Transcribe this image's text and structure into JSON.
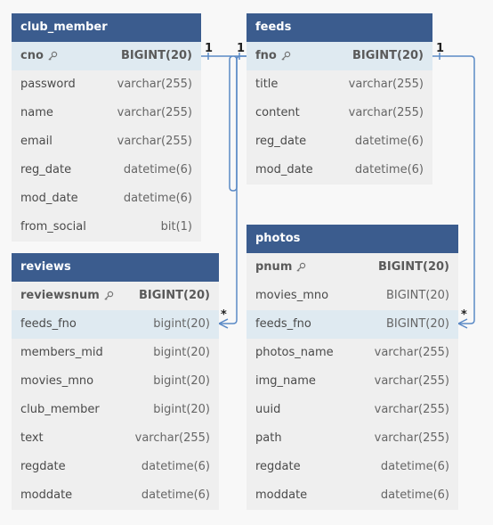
{
  "tables": {
    "club_member": {
      "title": "club_member",
      "rows": [
        {
          "name": "cno",
          "type": "BIGINT(20)",
          "pk": true
        },
        {
          "name": "password",
          "type": "varchar(255)"
        },
        {
          "name": "name",
          "type": "varchar(255)"
        },
        {
          "name": "email",
          "type": "varchar(255)"
        },
        {
          "name": "reg_date",
          "type": "datetime(6)"
        },
        {
          "name": "mod_date",
          "type": "datetime(6)"
        },
        {
          "name": "from_social",
          "type": "bit(1)"
        }
      ]
    },
    "feeds": {
      "title": "feeds",
      "rows": [
        {
          "name": "fno",
          "type": "BIGINT(20)",
          "pk": true
        },
        {
          "name": "title",
          "type": "varchar(255)"
        },
        {
          "name": "content",
          "type": "varchar(255)"
        },
        {
          "name": "reg_date",
          "type": "datetime(6)"
        },
        {
          "name": "mod_date",
          "type": "datetime(6)"
        }
      ]
    },
    "reviews": {
      "title": "reviews",
      "rows": [
        {
          "name": "reviewsnum",
          "type": "BIGINT(20)",
          "pk": true
        },
        {
          "name": "feeds_fno",
          "type": "bigint(20)"
        },
        {
          "name": "members_mid",
          "type": "bigint(20)"
        },
        {
          "name": "movies_mno",
          "type": "bigint(20)"
        },
        {
          "name": "club_member",
          "type": "bigint(20)"
        },
        {
          "name": "text",
          "type": "varchar(255)"
        },
        {
          "name": "regdate",
          "type": "datetime(6)"
        },
        {
          "name": "moddate",
          "type": "datetime(6)"
        }
      ]
    },
    "photos": {
      "title": "photos",
      "rows": [
        {
          "name": "pnum",
          "type": "BIGINT(20)",
          "pk": true
        },
        {
          "name": "movies_mno",
          "type": "BIGINT(20)"
        },
        {
          "name": "feeds_fno",
          "type": "BIGINT(20)"
        },
        {
          "name": "photos_name",
          "type": "varchar(255)"
        },
        {
          "name": "img_name",
          "type": "varchar(255)"
        },
        {
          "name": "uuid",
          "type": "varchar(255)"
        },
        {
          "name": "path",
          "type": "varchar(255)"
        },
        {
          "name": "regdate",
          "type": "datetime(6)"
        },
        {
          "name": "moddate",
          "type": "datetime(6)"
        }
      ]
    }
  },
  "relations": [
    {
      "from": "club_member.cno",
      "from_card": "1",
      "to": "feeds.fno",
      "to_card": "1"
    },
    {
      "from": "feeds.fno",
      "from_card": "1",
      "to": "reviews.feeds_fno",
      "to_card": "*"
    },
    {
      "from": "feeds.fno",
      "from_card": "1",
      "to": "photos.feeds_fno",
      "to_card": "*"
    }
  ],
  "colors": {
    "header": "#3b5c8e",
    "highlight_row": "#dfeaf1",
    "relation_line": "#5b8ac6",
    "background": "#f8f8f8"
  }
}
